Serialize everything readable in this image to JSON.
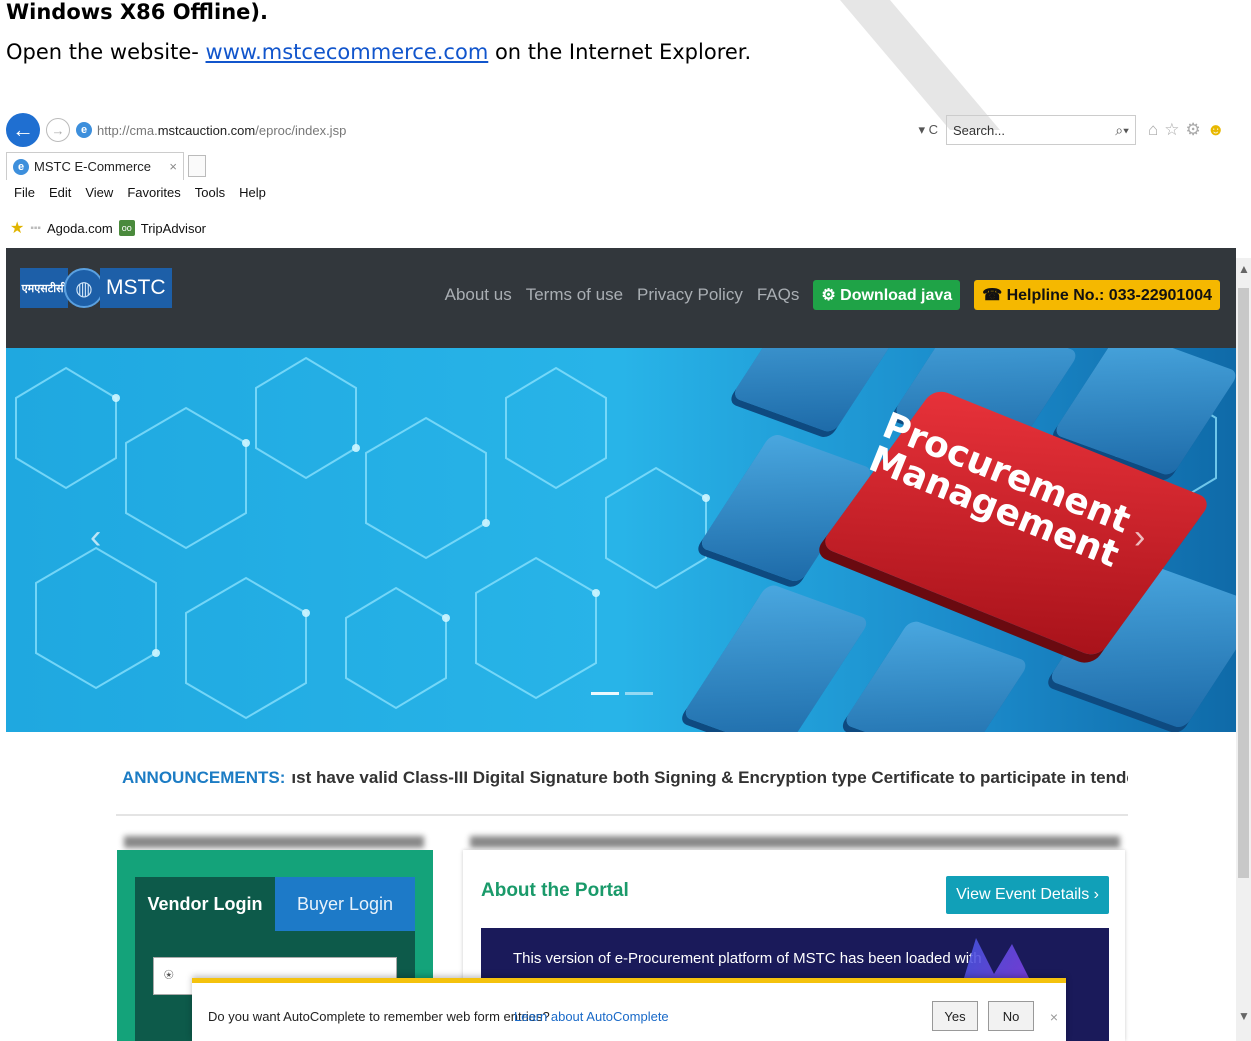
{
  "doc": {
    "heading": "Windows X86 Offline).",
    "line_prefix": "Open the website- ",
    "line_link": "www.mstcecommerce.com",
    "line_suffix": " on the Internet Explorer."
  },
  "browser": {
    "url_prefix": "http://cma.",
    "url_host": "mstcauction.com",
    "url_path": "/eproc/index.jsp",
    "url_tail": "▾ C",
    "search_placeholder": "Search...",
    "search_icon": "⌕▾",
    "tab_title": "MSTC E-Commerce",
    "tab_close": "×",
    "menu": [
      "File",
      "Edit",
      "View",
      "Favorites",
      "Tools",
      "Help"
    ],
    "favorites": [
      "Agoda.com",
      "TripAdvisor"
    ]
  },
  "site": {
    "logo_hindi": "एमएसटीसी",
    "logo_text": "MSTC",
    "nav": [
      "About us",
      "Terms of use",
      "Privacy Policy",
      "FAQs"
    ],
    "download_java": "Download java",
    "helpline": "Helpline No.: 033-22901004"
  },
  "hero": {
    "key_text_1": "Procurement",
    "key_text_2": "Management",
    "prev": "‹",
    "next": "›"
  },
  "announcements": {
    "label": "ANNOUNCEMENTS:",
    "text": "ıst have valid Class-III Digital Signature both Signing & Encryption type Certificate to participate in tenders.  Buyer/Vendor m"
  },
  "login": {
    "vendor_tab": "Vendor Login",
    "buyer_tab": "Buyer Login"
  },
  "about": {
    "title": "About the Portal",
    "button": "View Event Details ›",
    "body": "This version of e-Procurement platform of MSTC has been loaded with"
  },
  "autocomplete": {
    "question": "Do you want AutoComplete to remember web form entries?",
    "link": "Learn about AutoComplete",
    "yes": "Yes",
    "no": "No",
    "close": "×"
  },
  "colors": {
    "header_bg": "#32373c",
    "java_green": "#1fa347",
    "helpline_yellow": "#f5b800",
    "announce_blue": "#1c7cc4",
    "login_green": "#14a37a",
    "about_green": "#1a9a6a",
    "event_teal": "#11a0b8",
    "autocomplete_yellow": "#f4c20d"
  }
}
